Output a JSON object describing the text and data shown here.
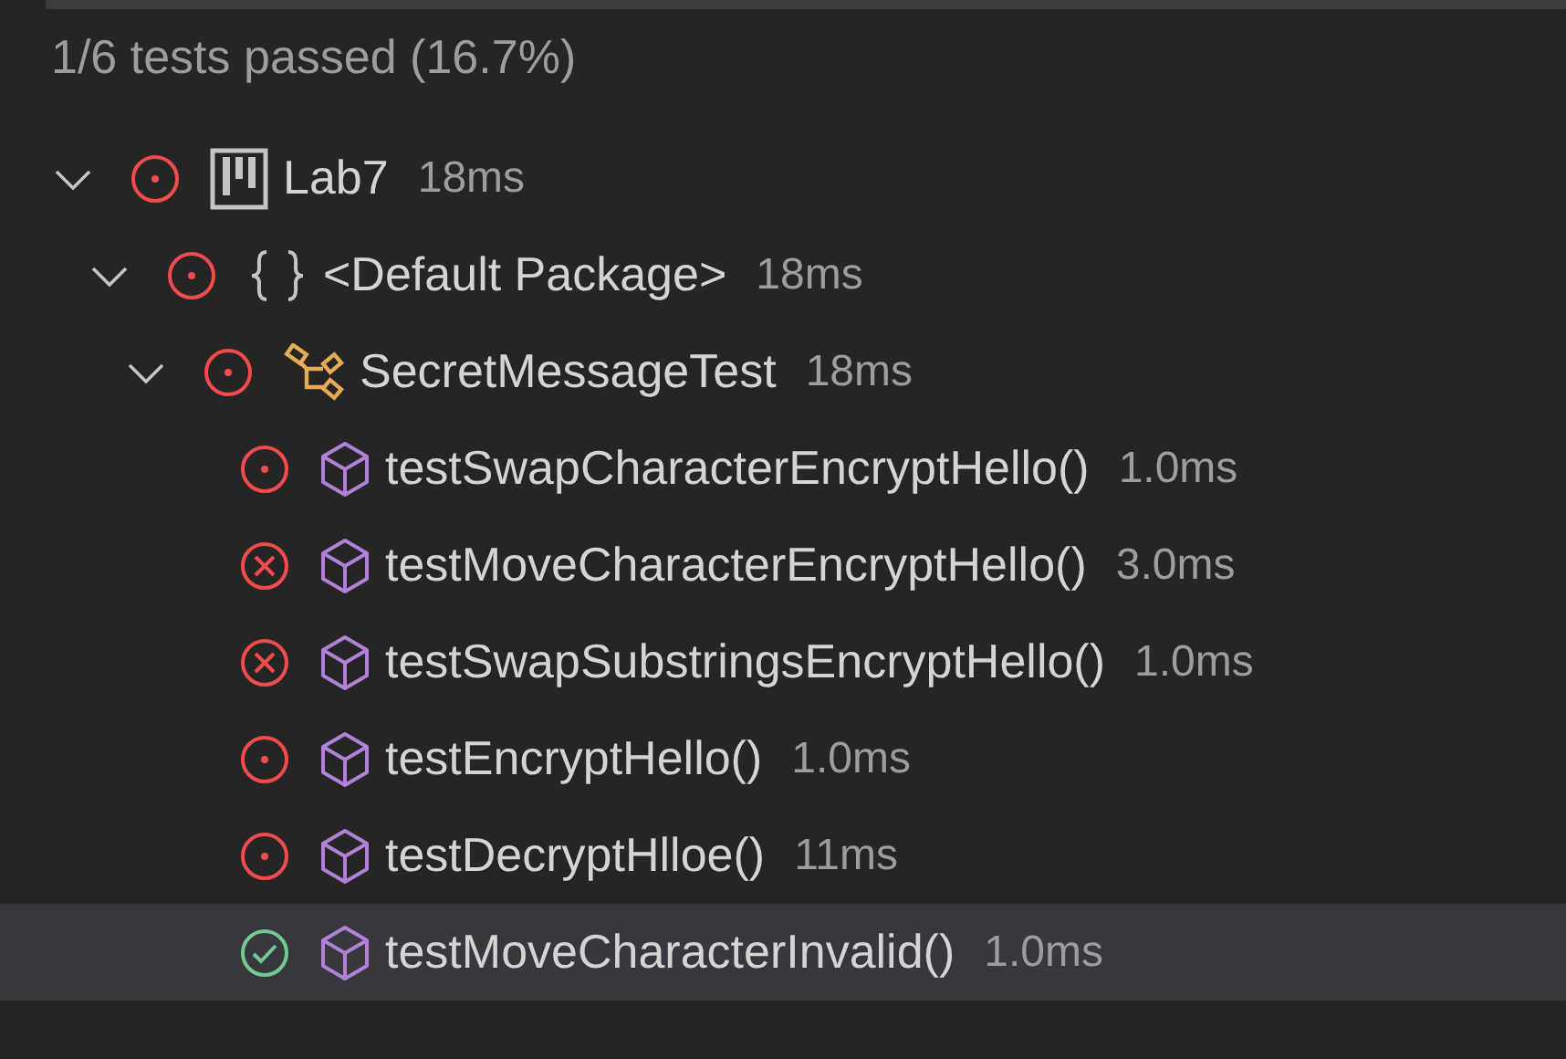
{
  "summary": "1/6 tests passed (16.7%)",
  "tree": [
    {
      "kind": "project",
      "failed": false,
      "passed": false,
      "label": "Lab7",
      "duration": "18ms",
      "expanded": true,
      "selected": false,
      "children": [
        {
          "kind": "package",
          "failed": false,
          "passed": false,
          "label": "<Default Package>",
          "duration": "18ms",
          "expanded": true,
          "selected": false,
          "children": [
            {
              "kind": "class",
              "failed": false,
              "passed": false,
              "label": "SecretMessageTest",
              "duration": "18ms",
              "expanded": true,
              "selected": false,
              "children": [
                {
                  "kind": "method",
                  "failed": false,
                  "passed": false,
                  "label": "testSwapCharacterEncryptHello()",
                  "duration": "1.0ms",
                  "selected": false
                },
                {
                  "kind": "method",
                  "failed": true,
                  "passed": false,
                  "label": "testMoveCharacterEncryptHello()",
                  "duration": "3.0ms",
                  "selected": false
                },
                {
                  "kind": "method",
                  "failed": true,
                  "passed": false,
                  "label": "testSwapSubstringsEncryptHello()",
                  "duration": "1.0ms",
                  "selected": false
                },
                {
                  "kind": "method",
                  "failed": false,
                  "passed": false,
                  "label": "testEncryptHello()",
                  "duration": "1.0ms",
                  "selected": false
                },
                {
                  "kind": "method",
                  "failed": false,
                  "passed": false,
                  "label": "testDecryptHlloe()",
                  "duration": "11ms",
                  "selected": false
                },
                {
                  "kind": "method",
                  "failed": false,
                  "passed": true,
                  "label": "testMoveCharacterInvalid()",
                  "duration": "1.0ms",
                  "selected": true
                }
              ]
            }
          ]
        }
      ]
    }
  ]
}
